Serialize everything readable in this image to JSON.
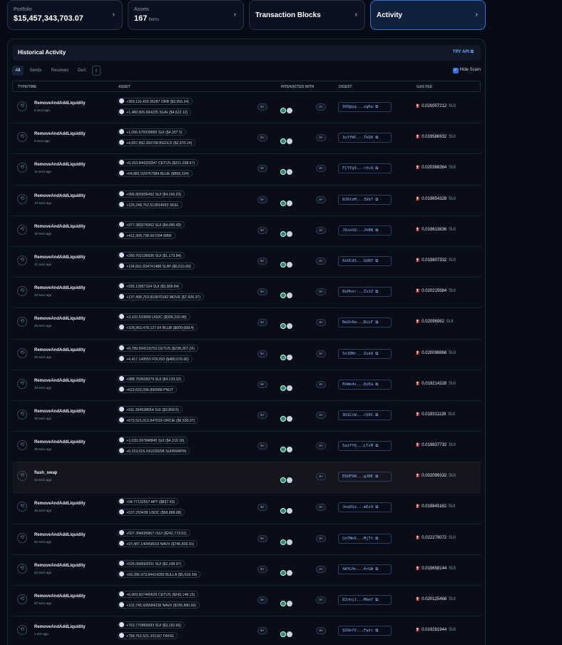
{
  "top_cards": [
    {
      "label": "Portfolio",
      "value": "$15,457,343,703.07"
    },
    {
      "label": "Assets",
      "value": "167",
      "unit": "Items"
    },
    {
      "title": "Transaction Blocks"
    },
    {
      "title": "Activity"
    }
  ],
  "panel": {
    "title": "Historical Activity",
    "try_api": "TRY API",
    "filters": [
      "All",
      "Sends",
      "Receives",
      "DeX"
    ],
    "hide_scam": "Hide Scam",
    "columns": {
      "type_time": "TYPE/TIME",
      "asset": "ASSET",
      "interacted": "INTERACTED WITH",
      "digest": "DIGEST",
      "gas": "GAS FEE"
    }
  },
  "rows": [
    {
      "fn": "RemoveAndAddLiquidity",
      "ago": "6 secs ago",
      "a1": "+369,110,420.36287 ORB ($3,956.34)",
      "a2": "+1,489,905.684225 SUAI ($4,622.12)",
      "p1": "5+",
      "p2": "4+",
      "digest": "99Q@yg...zgKa ⧉",
      "gas": "0.020007212",
      "unit": "SUI"
    },
    {
      "fn": "RemoveAndAddLiquidity",
      "ago": "9 secs ago",
      "a1": "+1,006.578339865 SUI ($4,307.5)",
      "a2": "+4,697,892.260708 BGOLD ($2,870.24)",
      "p1": "5+",
      "p2": "4+",
      "digest": "3xfYWC...7kQ8 ⧉",
      "gas": "0.019586932",
      "unit": "SUI"
    },
    {
      "fn": "RemoveAndAddLiquidity",
      "ago": "11 secs ago",
      "a1": "+8,163.844209347 CETUS ($221,038.67)",
      "a2": "+64,881.029757984 BLUE ($858,224)",
      "p1": "5+",
      "p2": "4+",
      "digest": "FCYYg9...rXcU ⧉",
      "gas": "0.020368364",
      "unit": "SUI"
    },
    {
      "fn": "RemoveAndAddLiquidity",
      "ago": "14 secs ago",
      "a1": "+996.800936492 SUI ($4,166.63)",
      "a2": "+125,248,762.513814693 SKEL",
      "p1": "5+",
      "p2": "4+",
      "digest": "8J6tzM...3Vb7 ⧉",
      "gas": "0.019654328",
      "unit": "SUI"
    },
    {
      "fn": "RemoveAndAddLiquidity",
      "ago": "16 secs ago",
      "a1": "+977.389276962 SUI ($4,085.49)",
      "a2": "+412,309,738.567294 MBR",
      "p1": "5+",
      "p2": "4+",
      "digest": "J9zoSQ...JhBB ⧉",
      "gas": "0.019613836",
      "unit": "SUI"
    },
    {
      "fn": "RemoveAndAddLiquidity",
      "ago": "21 secs ago",
      "a1": "+280.702136936 SUI ($1,173.84)",
      "a2": "+134,601.834741488 SUIP ($6,610.89)",
      "p1": "5+",
      "p2": "4+",
      "digest": "6oUCdS...GUN7 ⧉",
      "gas": "0.019807332",
      "unit": "SUI"
    },
    {
      "fn": "RemoveAndAddLiquidity",
      "ago": "24 secs ago",
      "a1": "+935.12867164 SUI ($3,908.84)",
      "a2": "+137,408,753.810870182 MOVE ($7,426.37)",
      "p1": "5+",
      "p2": "4+",
      "digest": "8uHhnr...Zs1Z ⧉",
      "gas": "0.020215984",
      "unit": "SUI"
    },
    {
      "fn": "RemoveAndAddLiquidity",
      "ago": "26 secs ago",
      "a1": "+3,102.533899 USDC ($336,316.98)",
      "a2": "+109,963,478,127.64 BLUB ($609,068.4)",
      "p1": "5+",
      "p2": "4+",
      "digest": "BeUs6m...BiLF ⧉",
      "gas": "0.02096982",
      "unit": "SUI"
    },
    {
      "fn": "RemoveAndAddLiquidity",
      "ago": "30 secs ago",
      "a1": "+8,789.504119753 CETUS ($238,267.24)",
      "a2": "+4,417.143553 FDUSD ($480,676.66)",
      "p1": "5+",
      "p2": "4+",
      "digest": "Sn18Nr...ZukQ ⧉",
      "gas": "0.020098868",
      "unit": "SUI"
    },
    {
      "fn": "RemoveAndAddLiquidity",
      "ago": "33 secs ago",
      "a1": "+988.759928379 SUI ($4,133.02)",
      "a2": "+623,622,096.890588 PNUT",
      "p1": "5+",
      "p2": "4+",
      "digest": "EbWe4x...QxEa ⧉",
      "gas": "0.019214228",
      "unit": "SUI"
    },
    {
      "fn": "RemoveAndAddLiquidity",
      "ago": "36 secs ago",
      "a1": "+911.364538654 SUI ($3,809.5)",
      "a2": "+673,521,012.847019 ORCIE ($6,530.07)",
      "p1": "5+",
      "p2": "4+",
      "digest": "3U1CcW...rU9C ⧉",
      "gas": "0.019311128",
      "unit": "SUI"
    },
    {
      "fn": "RemoveAndAddLiquidity",
      "ago": "39 secs ago",
      "a1": "+1,033.297848845 SUI ($4,319.18)",
      "a2": "+6,319,016.241039298 SUIRWAPIN",
      "p1": "5+",
      "p2": "4+",
      "digest": "5azfYQ...LTvM ⧉",
      "gas": "0.019837732",
      "unit": "SUI"
    },
    {
      "fn": "flash_swap",
      "ago": "42 secs ago",
      "a1": "",
      "a2": "",
      "p1": "",
      "p2": "3+",
      "digest": "EQUFUW...gJRE ⧉",
      "gas": "0.002099332",
      "unit": "SUI",
      "dim": true
    },
    {
      "fn": "RemoveAndAddLiquidity",
      "ago": "46 secs ago",
      "a1": "+94.77132557 APT ($837.43)",
      "a2": "+537.259438 USDC ($58,888.88)",
      "p1": "5+",
      "p2": "4+",
      "digest": "Jeq91o...mEz9 ⧉",
      "gas": "0.019841182",
      "unit": "SUI"
    },
    {
      "fn": "RemoveAndAddLiquidity",
      "ago": "51 secs ago",
      "a1": "+507.394695867 rSUI ($242,773.91)",
      "a2": "+97,487.140458019 NAVX ($746,609.91)",
      "p1": "5+",
      "p2": "4+",
      "digest": "Cm7NmS...Mj7t ⧉",
      "gas": "0.022279072",
      "unit": "SUI"
    },
    {
      "fn": "RemoveAndAddLiquidity",
      "ago": "54 secs ago",
      "a1": "+526.068692001 SUI ($2,198.97)",
      "a2": "+69,286.973.84414283 BULLA ($5,618.34)",
      "p1": "5+",
      "p2": "4+",
      "digest": "4AYLHc...4rGW ⧉",
      "gas": "0.019658144",
      "unit": "SUI"
    },
    {
      "fn": "RemoveAndAddLiquidity",
      "ago": "57 secs ago",
      "a1": "+8,969.507440625 CETUS ($243,148.15)",
      "a2": "+102,745.935684238 NAVX ($786,890.66)",
      "p1": "5+",
      "p2": "4+",
      "digest": "8JnhjJ...Mkm7 ⧉",
      "gas": "0.020125468",
      "unit": "SUI"
    },
    {
      "fn": "RemoveAndAddLiquidity",
      "ago": "1 min ago",
      "a1": "+763.770865683 SUI ($3,192.66)",
      "a2": "+784,762,521.331167 FROG",
      "p1": "5+",
      "p2": "4+",
      "digest": "929efV...Fwzc ⧉",
      "gas": "0.019281944",
      "unit": "SUI"
    }
  ]
}
